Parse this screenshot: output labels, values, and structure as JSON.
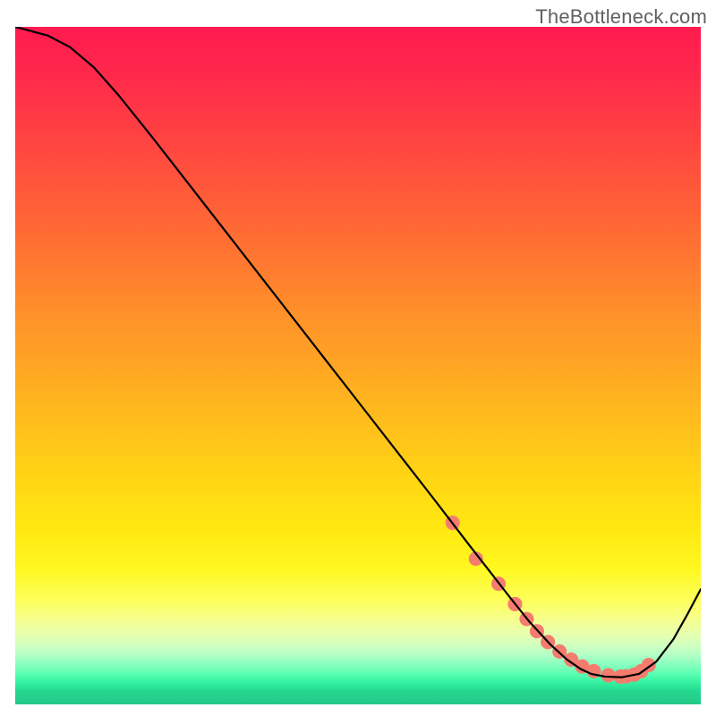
{
  "watermark": "TheBottleneck.com",
  "gradient": {
    "stops": [
      {
        "offset": 0.0,
        "color": "#ff1a4f"
      },
      {
        "offset": 0.08,
        "color": "#ff2b4a"
      },
      {
        "offset": 0.18,
        "color": "#ff4740"
      },
      {
        "offset": 0.3,
        "color": "#ff6a34"
      },
      {
        "offset": 0.42,
        "color": "#ff8f2a"
      },
      {
        "offset": 0.55,
        "color": "#ffb41f"
      },
      {
        "offset": 0.66,
        "color": "#ffd314"
      },
      {
        "offset": 0.74,
        "color": "#ffe811"
      },
      {
        "offset": 0.8,
        "color": "#fff820"
      },
      {
        "offset": 0.845,
        "color": "#feff5a"
      },
      {
        "offset": 0.875,
        "color": "#f6ff8e"
      },
      {
        "offset": 0.895,
        "color": "#e8ffad"
      },
      {
        "offset": 0.912,
        "color": "#d2ffc0"
      },
      {
        "offset": 0.928,
        "color": "#b0ffc5"
      },
      {
        "offset": 0.942,
        "color": "#86ffbf"
      },
      {
        "offset": 0.955,
        "color": "#5affb2"
      },
      {
        "offset": 0.966,
        "color": "#38f5a4"
      },
      {
        "offset": 0.98,
        "color": "#25d890"
      },
      {
        "offset": 1.0,
        "color": "#23c989"
      }
    ]
  },
  "chart_data": {
    "type": "line",
    "title": "",
    "xlabel": "",
    "ylabel": "",
    "x_range": [
      0,
      100
    ],
    "y_range": [
      0,
      100
    ],
    "series": [
      {
        "name": "bottleneck-curve",
        "x": [
          0.0,
          4.8,
          8.0,
          11.5,
          15.0,
          20.0,
          25.0,
          30.0,
          35.0,
          40.0,
          45.0,
          50.0,
          55.0,
          58.0,
          61.0,
          63.5,
          66.0,
          69.0,
          72.0,
          75.0,
          78.0,
          80.5,
          82.5,
          84.0,
          86.0,
          88.5,
          91.0,
          93.5,
          96.0,
          98.0,
          100.0
        ],
        "y": [
          100.0,
          98.7,
          97.0,
          94.0,
          90.0,
          83.7,
          77.2,
          70.7,
          64.2,
          57.7,
          51.2,
          44.7,
          38.2,
          34.3,
          30.4,
          27.1,
          23.8,
          19.9,
          16.0,
          12.2,
          8.9,
          6.6,
          5.2,
          4.5,
          4.1,
          4.0,
          4.5,
          6.3,
          9.6,
          13.2,
          17.0
        ]
      }
    ],
    "markers": {
      "name": "highlight-dots",
      "color": "#f47c6f",
      "radius_rel": 1.05,
      "x": [
        63.8,
        67.2,
        70.5,
        72.9,
        74.6,
        76.1,
        77.7,
        79.4,
        81.1,
        82.7,
        84.4,
        86.5,
        88.3,
        89.1,
        90.3,
        91.3,
        92.4
      ],
      "y": [
        26.8,
        21.5,
        17.8,
        14.8,
        12.6,
        10.8,
        9.2,
        7.8,
        6.6,
        5.6,
        4.9,
        4.3,
        4.1,
        4.15,
        4.4,
        4.9,
        5.8
      ]
    }
  }
}
